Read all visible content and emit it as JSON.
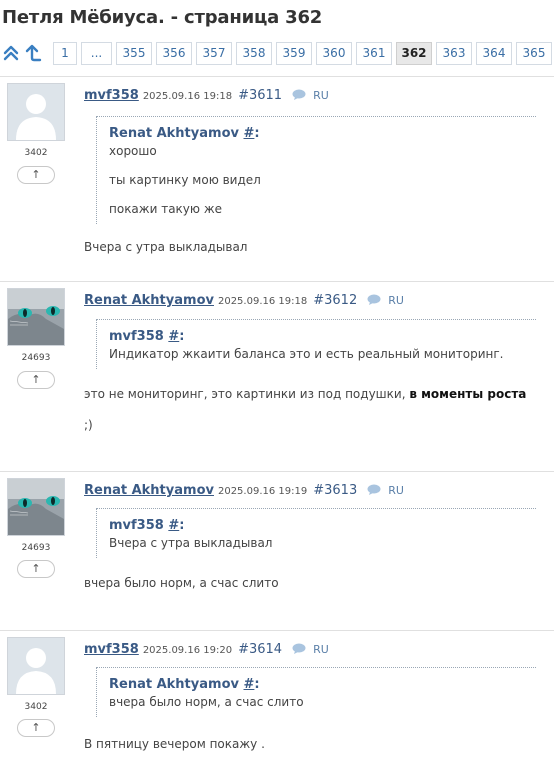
{
  "page_title": "Петля Мёбиуса. - страница 362",
  "pager": {
    "pages": [
      "1",
      "...",
      "355",
      "356",
      "357",
      "358",
      "359",
      "360",
      "361",
      "362",
      "363",
      "364",
      "365"
    ],
    "current": "362"
  },
  "posts": [
    {
      "author": "mvf358",
      "date": "2025.09.16 19:18",
      "number": "#3611",
      "lang": "RU",
      "rating": "3402",
      "vote": "↑",
      "avatar": "default-user-icon",
      "quote": {
        "author": "Renat Akhtyamov",
        "hash": "#",
        "colon": ":",
        "lines": [
          "хорошо",
          "ты картинку мою видел",
          "покажи такую же"
        ]
      },
      "body": [
        "Вчера с утра выкладывал"
      ]
    },
    {
      "author": "Renat Akhtyamov",
      "date": "2025.09.16 19:18",
      "number": "#3612",
      "lang": "RU",
      "rating": "24693",
      "vote": "↑",
      "avatar": "cat-photo",
      "quote": {
        "author": "mvf358",
        "hash": "#",
        "colon": ":",
        "lines": [
          "Индикатор жкаити баланса это и есть реальный мониторинг."
        ]
      },
      "body_main": "это не мониторинг, это картинки из под подушки, ",
      "body_bold": "в моменты роста",
      "body_tail": ";)"
    },
    {
      "author": "Renat Akhtyamov",
      "date": "2025.09.16 19:19",
      "number": "#3613",
      "lang": "RU",
      "rating": "24693",
      "vote": "↑",
      "avatar": "cat-photo",
      "quote": {
        "author": "mvf358",
        "hash": "#",
        "colon": ":",
        "lines": [
          "Вчера с утра выкладывал"
        ]
      },
      "body": [
        "вчера было норм, а счас слито"
      ]
    },
    {
      "author": "mvf358",
      "date": "2025.09.16 19:20",
      "number": "#3614",
      "lang": "RU",
      "rating": "3402",
      "vote": "↑",
      "avatar": "default-user-icon",
      "quote": {
        "author": "Renat Akhtyamov",
        "hash": "#",
        "colon": ":",
        "lines": [
          "вчера было норм, а счас слито"
        ]
      },
      "body": [
        "В пятницу вечером покажу ."
      ]
    }
  ],
  "colors": {
    "link": "#3a5a85",
    "pager_border": "#d4dbe3",
    "current_page_bg": "#e8e8e8"
  }
}
